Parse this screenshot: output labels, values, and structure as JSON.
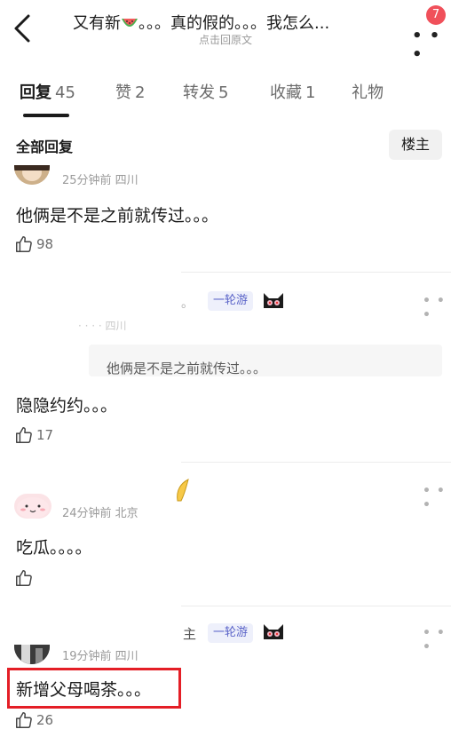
{
  "header": {
    "title_part1": "又有新",
    "title_part2": "。。。真的假的。。。我怎么...",
    "subtitle": "点击回原文",
    "notification_count": "7"
  },
  "tabs": [
    {
      "label": "回复",
      "count": "45"
    },
    {
      "label": "赞",
      "count": "2"
    },
    {
      "label": "转发",
      "count": "5"
    },
    {
      "label": "收藏",
      "count": "1"
    },
    {
      "label": "礼物",
      "count": ""
    }
  ],
  "section": {
    "title": "全部回复",
    "owner_button": "楼主"
  },
  "comments": [
    {
      "meta": "25分钟前 四川",
      "text": "他俩是不是之前就传过。。。",
      "likes": "98"
    },
    {
      "tag": "一轮游",
      "ghost_prefix": "。",
      "ghost_meta": "· · · · 四川",
      "quote": "他俩是不是之前就传过。。。",
      "quote_prefix": "、",
      "text": "隐隐约约。。。",
      "likes": "17"
    },
    {
      "meta": "24分钟前 北京",
      "text": "吃瓜。。。。",
      "likes": ""
    },
    {
      "owner_fragment": "主",
      "tag": "一轮游",
      "meta": "19分钟前 四川",
      "text": "新增父母喝茶。。。",
      "likes": "26"
    }
  ],
  "colors": {
    "accent_red": "#e41e26",
    "badge_red": "#f0505a",
    "tag_blue": "#5a63c8"
  }
}
